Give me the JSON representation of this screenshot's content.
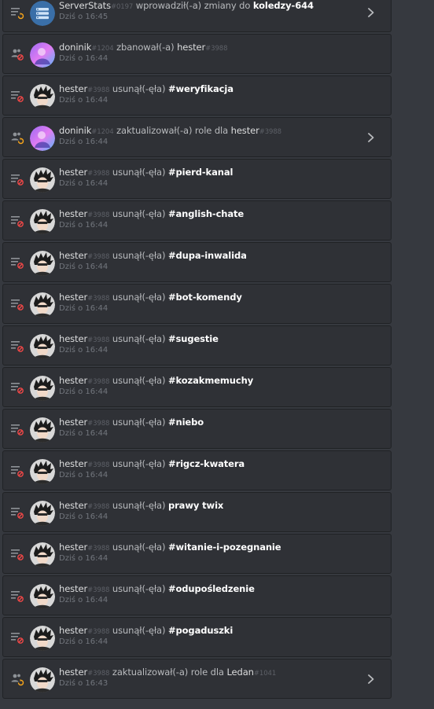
{
  "entries": [
    {
      "actor": "ServerStats",
      "actor_tag": "#0197",
      "verb": "wprowadził(-a) zmiany do",
      "target": "koledzy-644",
      "target_tag": "",
      "time": "Dziś o 16:45",
      "icon": "channel-update-icon",
      "avatar": "serverstats",
      "expandable": true
    },
    {
      "actor": "doninik",
      "actor_tag": "#1204",
      "verb": "zbanował(-a)",
      "target": "hester",
      "target_tag": "#3988",
      "time": "Dziś o 16:44",
      "icon": "member-ban-icon",
      "avatar": "doninik",
      "expandable": false
    },
    {
      "actor": "hester",
      "actor_tag": "#3988",
      "verb": "usunął(-ęła)",
      "target": "#weryfikacja",
      "target_tag": "",
      "time": "Dziś o 16:44",
      "icon": "channel-delete-icon",
      "avatar": "hester",
      "expandable": false
    },
    {
      "actor": "doninik",
      "actor_tag": "#1204",
      "verb": "zaktualizował(-a) role dla",
      "target": "hester",
      "target_tag": "#3988",
      "time": "Dziś o 16:44",
      "icon": "member-role-icon",
      "avatar": "doninik",
      "expandable": true
    },
    {
      "actor": "hester",
      "actor_tag": "#3988",
      "verb": "usunął(-ęła)",
      "target": "#pierd-kanal",
      "target_tag": "",
      "time": "Dziś o 16:44",
      "icon": "channel-delete-icon",
      "avatar": "hester",
      "expandable": false
    },
    {
      "actor": "hester",
      "actor_tag": "#3988",
      "verb": "usunął(-ęła)",
      "target": "#anglish-chate",
      "target_tag": "",
      "time": "Dziś o 16:44",
      "icon": "channel-delete-icon",
      "avatar": "hester",
      "expandable": false
    },
    {
      "actor": "hester",
      "actor_tag": "#3988",
      "verb": "usunął(-ęła)",
      "target": "#dupa-inwalida",
      "target_tag": "",
      "time": "Dziś o 16:44",
      "icon": "channel-delete-icon",
      "avatar": "hester",
      "expandable": false
    },
    {
      "actor": "hester",
      "actor_tag": "#3988",
      "verb": "usunął(-ęła)",
      "target": "#bot-komendy",
      "target_tag": "",
      "time": "Dziś o 16:44",
      "icon": "channel-delete-icon",
      "avatar": "hester",
      "expandable": false
    },
    {
      "actor": "hester",
      "actor_tag": "#3988",
      "verb": "usunął(-ęła)",
      "target": "#sugestie",
      "target_tag": "",
      "time": "Dziś o 16:44",
      "icon": "channel-delete-icon",
      "avatar": "hester",
      "expandable": false
    },
    {
      "actor": "hester",
      "actor_tag": "#3988",
      "verb": "usunął(-ęła)",
      "target": "#kozakmemuchy",
      "target_tag": "",
      "time": "Dziś o 16:44",
      "icon": "channel-delete-icon",
      "avatar": "hester",
      "expandable": false
    },
    {
      "actor": "hester",
      "actor_tag": "#3988",
      "verb": "usunął(-ęła)",
      "target": "#niebo",
      "target_tag": "",
      "time": "Dziś o 16:44",
      "icon": "channel-delete-icon",
      "avatar": "hester",
      "expandable": false
    },
    {
      "actor": "hester",
      "actor_tag": "#3988",
      "verb": "usunął(-ęła)",
      "target": "#rigcz-kwatera",
      "target_tag": "",
      "time": "Dziś o 16:44",
      "icon": "channel-delete-icon",
      "avatar": "hester",
      "expandable": false
    },
    {
      "actor": "hester",
      "actor_tag": "#3988",
      "verb": "usunął(-ęła)",
      "target": "prawy twix",
      "target_tag": "",
      "time": "Dziś o 16:44",
      "icon": "channel-delete-icon",
      "avatar": "hester",
      "expandable": false
    },
    {
      "actor": "hester",
      "actor_tag": "#3988",
      "verb": "usunął(-ęła)",
      "target": "#witanie-i-pozegnanie",
      "target_tag": "",
      "time": "Dziś o 16:44",
      "icon": "channel-delete-icon",
      "avatar": "hester",
      "expandable": false
    },
    {
      "actor": "hester",
      "actor_tag": "#3988",
      "verb": "usunął(-ęła)",
      "target": "#odupośledzenie",
      "target_tag": "",
      "time": "Dziś o 16:44",
      "icon": "channel-delete-icon",
      "avatar": "hester",
      "expandable": false
    },
    {
      "actor": "hester",
      "actor_tag": "#3988",
      "verb": "usunął(-ęła)",
      "target": "#pogaduszki",
      "target_tag": "",
      "time": "Dziś o 16:44",
      "icon": "channel-delete-icon",
      "avatar": "hester",
      "expandable": false
    },
    {
      "actor": "hester",
      "actor_tag": "#3988",
      "verb": "zaktualizował(-a) role dla",
      "target": "Ledan",
      "target_tag": "#1041",
      "time": "Dziś o 16:43",
      "icon": "member-role-icon",
      "avatar": "hester",
      "expandable": true
    }
  ],
  "colors": {
    "background": "#36393f",
    "row_background": "#2f3136",
    "delete_accent": "#f04747",
    "update_accent": "#faa61a"
  }
}
